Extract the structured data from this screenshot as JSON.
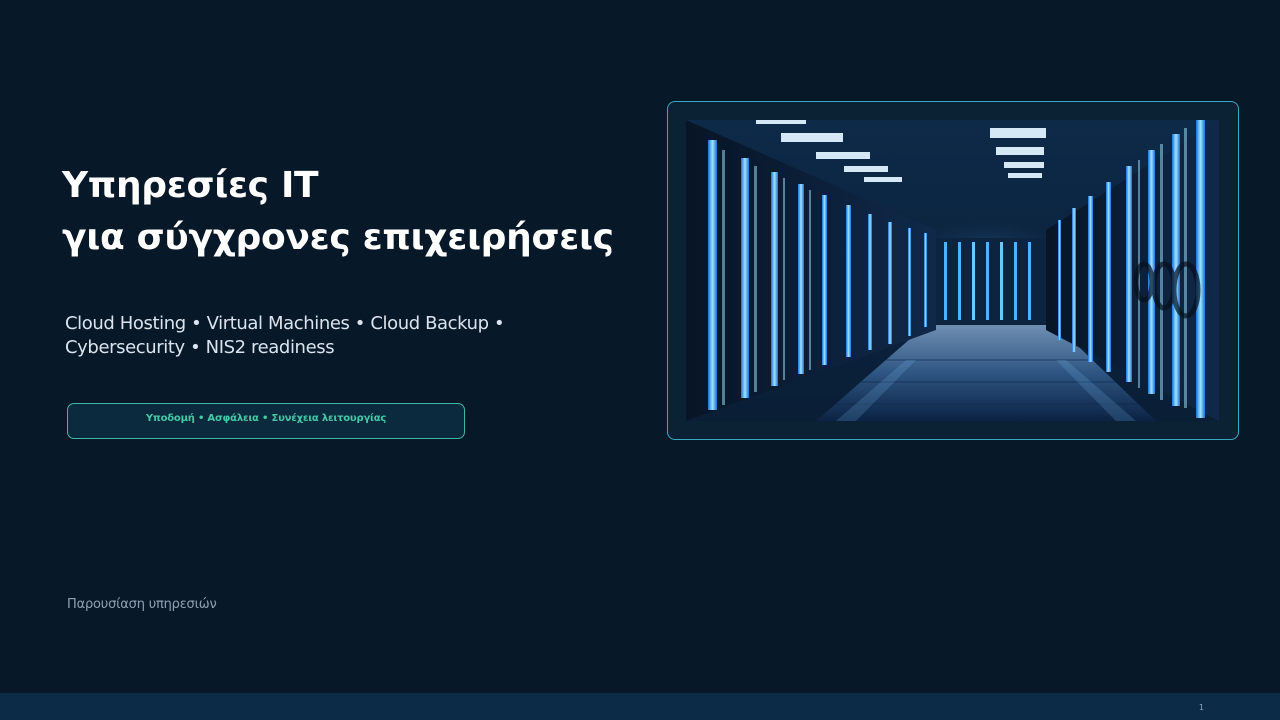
{
  "slide": {
    "title_line1": "Υπηρεσίες IT",
    "title_line2": "για σύγχρονες επιχειρήσεις",
    "subtitle_line1": "Cloud Hosting • Virtual Machines • Cloud Backup •",
    "subtitle_line2": "Cybersecurity • NIS2 readiness",
    "tagline": "Υποδομή • Ασφάλεια • Συνέχεια λειτουργίας",
    "footer_label": "Παρουσίαση υπηρεσιών",
    "page_number": "1",
    "image_icon": "server-room-photo"
  },
  "colors": {
    "background": "#071828",
    "bottom_bar": "#0b2b47",
    "accent_teal": "#3fb6a8",
    "tagline_text": "#45c9a6",
    "frame_border": "#3aa7c4"
  }
}
